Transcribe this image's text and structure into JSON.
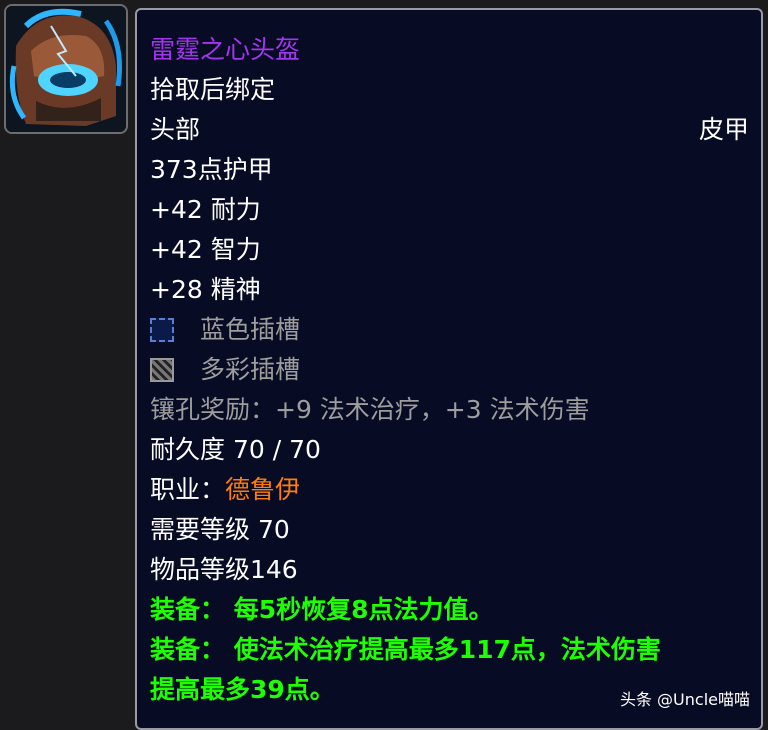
{
  "item": {
    "name": "雷霆之心头盔",
    "binding": "拾取后绑定",
    "slot": "头部",
    "armor_type": "皮甲",
    "armor": "373点护甲",
    "stats": [
      "+42 耐力",
      "+42 智力",
      "+28 精神"
    ],
    "sockets": [
      {
        "label": "蓝色插槽",
        "icon": "blue-socket-icon"
      },
      {
        "label": "多彩插槽",
        "icon": "meta-socket-icon"
      }
    ],
    "socket_bonus": "镶孔奖励：+9 法术治疗，+3 法术伤害",
    "durability": "耐久度 70 / 70",
    "class_label": "职业：",
    "class_name": "德鲁伊",
    "required_level": "需要等级 70",
    "item_level": "物品等级146",
    "equip_effects": [
      "装备：  每5秒恢复8点法力值。",
      "装备：  使法术治疗提高最多117点，法术伤害",
      "提高最多39点。"
    ]
  },
  "icon": "helmet-icon",
  "watermark": "头条 @Uncle喵喵",
  "colors": {
    "epic": "#a335ee",
    "druid": "#ff7d0a",
    "equip": "#1eff00",
    "gray": "#9d9d9d",
    "tooltip_bg": "#070b24"
  }
}
